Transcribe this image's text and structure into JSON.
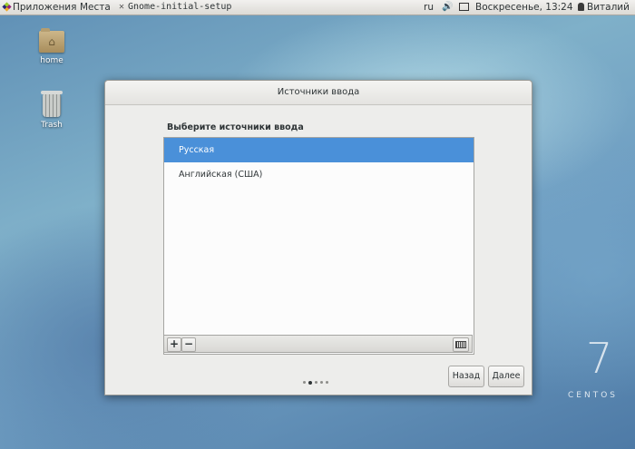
{
  "top_panel": {
    "apps_label": "Приложения",
    "places_label": "Места",
    "window_label": "Gnome-initial-setup",
    "language": "ru",
    "clock": "Воскресенье, 13:24",
    "user": "Виталий"
  },
  "desktop": {
    "icons": [
      {
        "label": "home",
        "icon": "folder-home-icon"
      },
      {
        "label": "Trash",
        "icon": "trash-icon"
      }
    ]
  },
  "dialog": {
    "title": "Источники ввода",
    "heading": "Выберите источники ввода",
    "sources": [
      {
        "label": "Русская",
        "selected": true
      },
      {
        "label": "Английская (США)",
        "selected": false
      }
    ],
    "toolbar": {
      "add_label": "+",
      "remove_label": "−"
    },
    "pagination": {
      "total": 5,
      "current": 2
    },
    "back_label": "Назад",
    "next_label": "Далее"
  },
  "watermark": {
    "number": "7",
    "word": "CENTOS"
  },
  "colors": {
    "selection": "#4a90d9",
    "panel": "#e8e7e4"
  }
}
